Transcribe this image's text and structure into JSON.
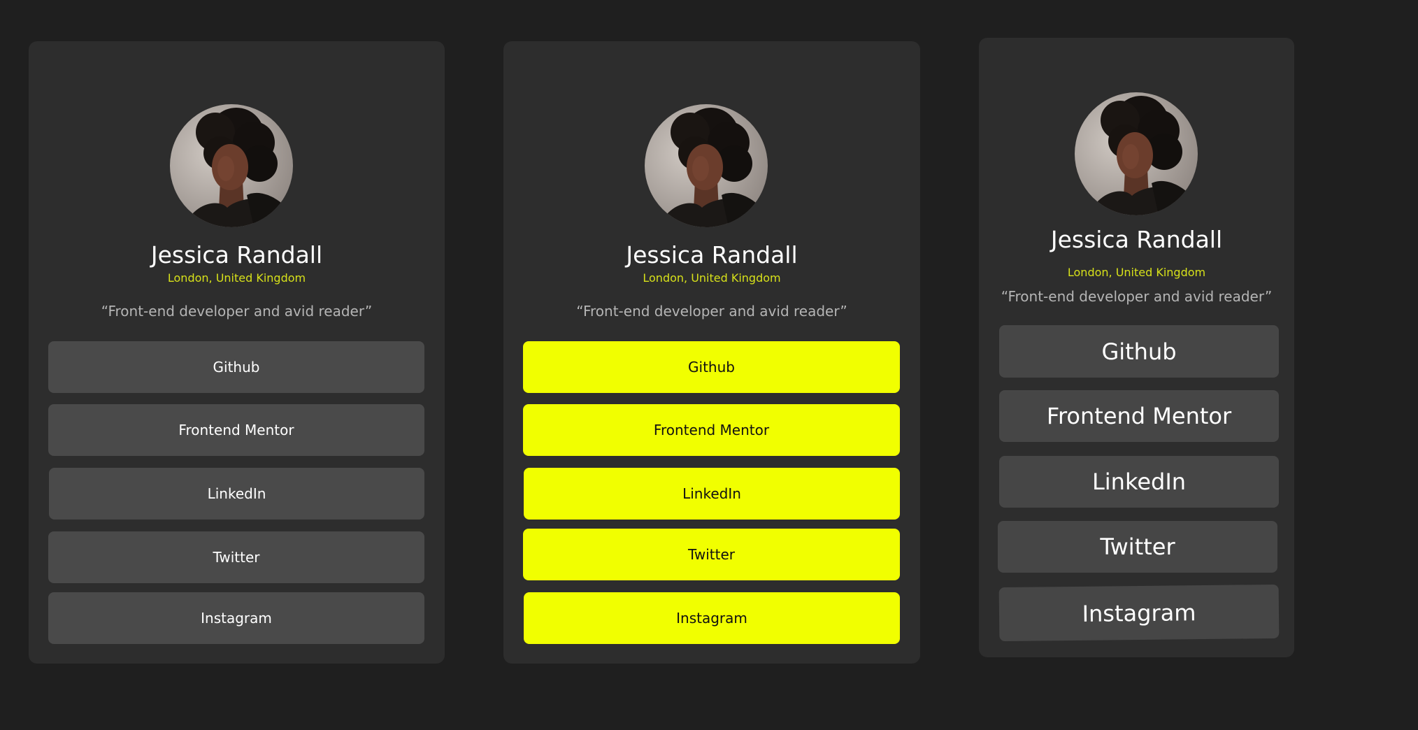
{
  "colors": {
    "page_background": "#1f1f1f",
    "card_background": "#2d2d2d",
    "button_default": "#4a4a4a",
    "button_highlight": "#f1ff00",
    "accent_location": "#d7e11a",
    "bio_text": "#b5b5b5"
  },
  "cards": [
    {
      "variant": "default",
      "avatar_icon": "profile-photo",
      "name": "Jessica Randall",
      "location": "London, United Kingdom",
      "bio": "“Front-end developer and avid reader”",
      "links": [
        {
          "label": "Github"
        },
        {
          "label": "Frontend Mentor"
        },
        {
          "label": "LinkedIn"
        },
        {
          "label": "Twitter"
        },
        {
          "label": "Instagram"
        }
      ]
    },
    {
      "variant": "highlighted",
      "avatar_icon": "profile-photo",
      "name": "Jessica Randall",
      "location": "London, United Kingdom",
      "bio": "“Front-end developer and avid reader”",
      "links": [
        {
          "label": "Github"
        },
        {
          "label": "Frontend Mentor"
        },
        {
          "label": "LinkedIn"
        },
        {
          "label": "Twitter"
        },
        {
          "label": "Instagram"
        }
      ]
    },
    {
      "variant": "large-text",
      "avatar_icon": "profile-photo",
      "name": "Jessica Randall",
      "location": "London, United Kingdom",
      "bio": "“Front-end developer and avid reader”",
      "links": [
        {
          "label": "Github"
        },
        {
          "label": "Frontend Mentor"
        },
        {
          "label": "LinkedIn"
        },
        {
          "label": "Twitter"
        },
        {
          "label": "Instagram"
        }
      ]
    }
  ]
}
